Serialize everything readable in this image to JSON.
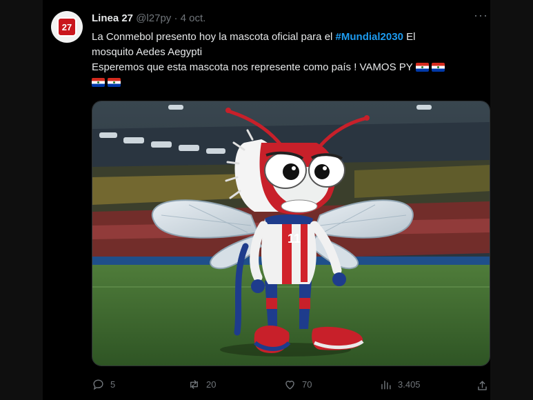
{
  "tweet": {
    "author_name": "Linea 27",
    "handle": "@l27py",
    "separator": "·",
    "date": "4 oct.",
    "avatar_text": "27",
    "text_line1_a": "La Conmebol presento hoy la mascota oficial para el ",
    "hashtag": "#Mundial2030",
    "text_line1_b": " El",
    "text_line2": "mosquito Aedes Aegypti",
    "text_line3": "Esperemos que esta mascota nos represente como país ! VAMOS PY",
    "flags": [
      "paraguay-flag",
      "paraguay-flag",
      "paraguay-flag",
      "paraguay-flag"
    ],
    "mascot_number": "11"
  },
  "actions": {
    "replies": "5",
    "reposts": "20",
    "likes": "70",
    "views": "3.405"
  },
  "colors": {
    "background": "#000000",
    "text": "#e7e9ea",
    "muted": "#71767b",
    "link": "#1d9bf0"
  }
}
